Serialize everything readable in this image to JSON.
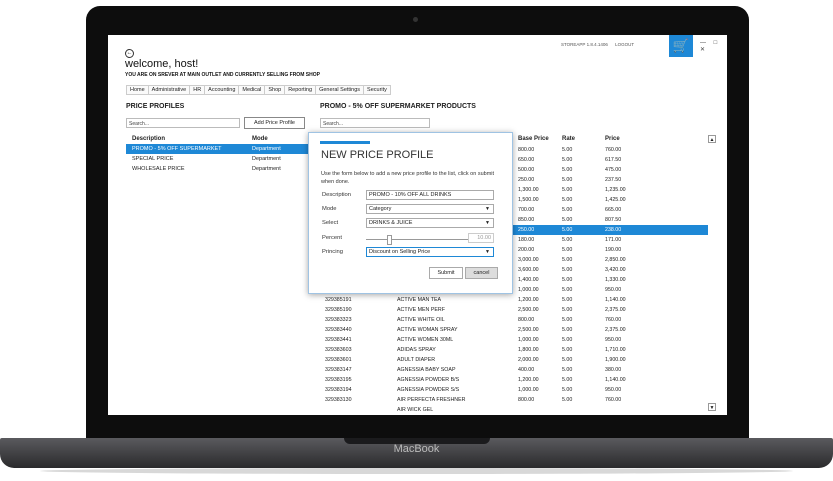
{
  "device": {
    "brand": "MacBook"
  },
  "header": {
    "welcome": "welcome, host!",
    "subtitle": "YOU ARE ON SREVER AT MAIN OUTLET AND CURRENTLY SELLING FROM SHOP",
    "app_version": "STOREAPP 1.8.4.1406",
    "logout": "LOGOUT",
    "cart_icon": "cart-icon",
    "window_controls": "— □ ✕"
  },
  "menu": [
    "Home",
    "Administrative",
    "HR",
    "Accounting",
    "Medical",
    "Shop",
    "Reporting",
    "General Settings",
    "Security"
  ],
  "left_panel": {
    "title": "PRICE PROFILES",
    "search_placeholder": "Search...",
    "add_button": "Add Price Profile",
    "columns": [
      "Description",
      "Mode"
    ],
    "rows": [
      {
        "description": "PROMO - 5% OFF SUPERMARKET",
        "mode": "Department",
        "selected": true
      },
      {
        "description": "SPECIAL PRICE",
        "mode": "Department",
        "selected": false
      },
      {
        "description": "WHOLESALE PRICE",
        "mode": "Department",
        "selected": false
      }
    ]
  },
  "right_panel": {
    "title": "PROMO - 5% OFF SUPERMARKET PRODUCTS",
    "search_placeholder": "Search...",
    "columns": [
      "Base Price",
      "Rate",
      "Price"
    ],
    "rows": [
      {
        "code": "",
        "name": "",
        "base": "800.00",
        "rate": "5.00",
        "price": "760.00"
      },
      {
        "code": "",
        "name": "",
        "base": "650.00",
        "rate": "5.00",
        "price": "617.50"
      },
      {
        "code": "",
        "name": "",
        "base": "500.00",
        "rate": "5.00",
        "price": "475.00"
      },
      {
        "code": "",
        "name": "",
        "base": "250.00",
        "rate": "5.00",
        "price": "237.50"
      },
      {
        "code": "",
        "name": "",
        "base": "1,300.00",
        "rate": "5.00",
        "price": "1,235.00"
      },
      {
        "code": "",
        "name": "",
        "base": "1,500.00",
        "rate": "5.00",
        "price": "1,425.00"
      },
      {
        "code": "",
        "name": "",
        "base": "700.00",
        "rate": "5.00",
        "price": "665.00"
      },
      {
        "code": "",
        "name": "",
        "base": "850.00",
        "rate": "5.00",
        "price": "807.50"
      },
      {
        "code": "",
        "name": "",
        "base": "250.00",
        "rate": "5.00",
        "price": "238.00",
        "selected": true
      },
      {
        "code": "",
        "name": "",
        "base": "180.00",
        "rate": "5.00",
        "price": "171.00"
      },
      {
        "code": "",
        "name": "",
        "base": "200.00",
        "rate": "5.00",
        "price": "190.00"
      },
      {
        "code": "",
        "name": "",
        "base": "3,000.00",
        "rate": "5.00",
        "price": "2,850.00"
      },
      {
        "code": "",
        "name": "",
        "base": "3,600.00",
        "rate": "5.00",
        "price": "3,420.00"
      },
      {
        "code": "",
        "name": "",
        "base": "1,400.00",
        "rate": "5.00",
        "price": "1,330.00"
      },
      {
        "code": "",
        "name": "",
        "base": "1,000.00",
        "rate": "5.00",
        "price": "950.00"
      },
      {
        "code": "329385191",
        "name": "ACTIVE MAN TEA",
        "base": "1,200.00",
        "rate": "5.00",
        "price": "1,140.00"
      },
      {
        "code": "329385190",
        "name": "ACTIVE MEN PERF",
        "base": "2,500.00",
        "rate": "5.00",
        "price": "2,375.00"
      },
      {
        "code": "329383323",
        "name": "ACTIVE WHITE OIL",
        "base": "800.00",
        "rate": "5.00",
        "price": "760.00"
      },
      {
        "code": "329383440",
        "name": "ACTIVE WOMAN SPRAY",
        "base": "2,500.00",
        "rate": "5.00",
        "price": "2,375.00"
      },
      {
        "code": "329383441",
        "name": "ACTIVE WOMEN 30ML",
        "base": "1,000.00",
        "rate": "5.00",
        "price": "950.00"
      },
      {
        "code": "329383603",
        "name": "ADIDAS SPRAY",
        "base": "1,800.00",
        "rate": "5.00",
        "price": "1,710.00"
      },
      {
        "code": "329383601",
        "name": "ADULT DIAPER",
        "base": "2,000.00",
        "rate": "5.00",
        "price": "1,900.00"
      },
      {
        "code": "329383147",
        "name": "AGNESSIA BABY SOAP",
        "base": "400.00",
        "rate": "5.00",
        "price": "380.00"
      },
      {
        "code": "329383195",
        "name": "AGNESSIA POWDER B/S",
        "base": "1,200.00",
        "rate": "5.00",
        "price": "1,140.00"
      },
      {
        "code": "329383194",
        "name": "AGNESSIA POWDER S/S",
        "base": "1,000.00",
        "rate": "5.00",
        "price": "950.00"
      },
      {
        "code": "329383130",
        "name": "AIR PERFECTA FRESHNER",
        "base": "800.00",
        "rate": "5.00",
        "price": "760.00"
      },
      {
        "code": "",
        "name": "AIR WICK GEL",
        "base": "",
        "rate": "",
        "price": ""
      }
    ]
  },
  "dialog": {
    "title": "NEW PRICE PROFILE",
    "description": "Use the form below to add a new price profile to the list, click on submit when done.",
    "fields": {
      "description_label": "Description",
      "description_value": "PROMO - 10% OFF ALL DRINKS",
      "mode_label": "Mode",
      "mode_value": "Category",
      "select_label": "Select",
      "select_value": "DRINKS & JUICE",
      "percent_label": "Percent",
      "percent_value": "10.00",
      "pricing_label": "Princing",
      "pricing_value": "Discount on Selling Price"
    },
    "submit": "Submit",
    "cancel": "cancel"
  },
  "colors": {
    "accent": "#1e88d6"
  }
}
